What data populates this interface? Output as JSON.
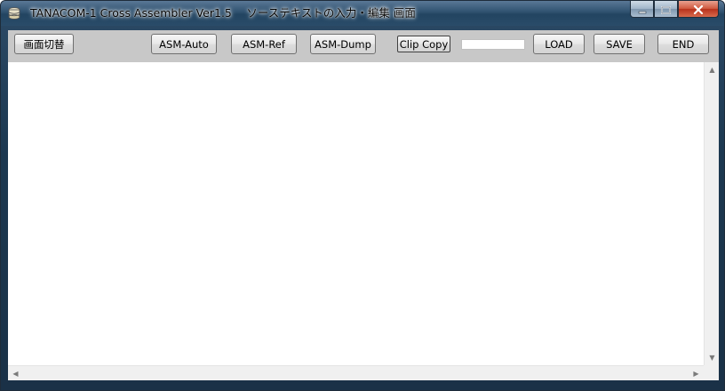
{
  "window": {
    "title": "TANACOM-1 Cross Assembler Ver1.5　 ソーステキストの入力・編集 画面"
  },
  "caption": {
    "minimize": "▁",
    "maximize": "☐",
    "close": "✕"
  },
  "toolbar": {
    "screen_switch": "画面切替",
    "asm_auto": "ASM-Auto",
    "asm_ref": "ASM-Ref",
    "asm_dump": "ASM-Dump",
    "clip_copy": "Clip Copy",
    "field_value": "",
    "load": "LOAD",
    "save": "SAVE",
    "end": "END"
  },
  "editor": {
    "content": ""
  },
  "scrollbars": {
    "up": "▲",
    "down": "▼",
    "left": "◀",
    "right": "▶"
  }
}
